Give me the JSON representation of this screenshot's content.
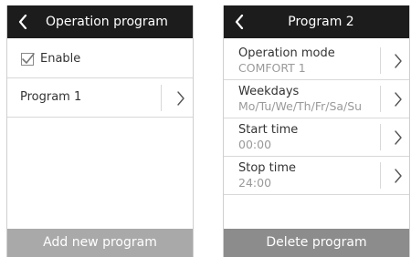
{
  "left": {
    "title": "Operation program",
    "enable_label": "Enable",
    "enable_checked": true,
    "program_label": "Program 1",
    "add_button": "Add new program"
  },
  "right": {
    "title": "Program 2",
    "rows": [
      {
        "label": "Operation mode",
        "value": "COMFORT 1"
      },
      {
        "label": "Weekdays",
        "value": "Mo/Tu/We/Th/Fr/Sa/Su"
      },
      {
        "label": "Start time",
        "value": "00:00"
      },
      {
        "label": "Stop time",
        "value": "24:00"
      }
    ],
    "delete_button": "Delete program"
  },
  "icons": {
    "back": "chevron-left-icon",
    "forward": "chevron-right-icon",
    "check": "checkmark-icon"
  },
  "colors": {
    "header_bg": "#1c1c1c",
    "add_button_bg": "#a9a9a9",
    "delete_button_bg": "#8c8c8c",
    "value_text": "#9a9a9a"
  }
}
